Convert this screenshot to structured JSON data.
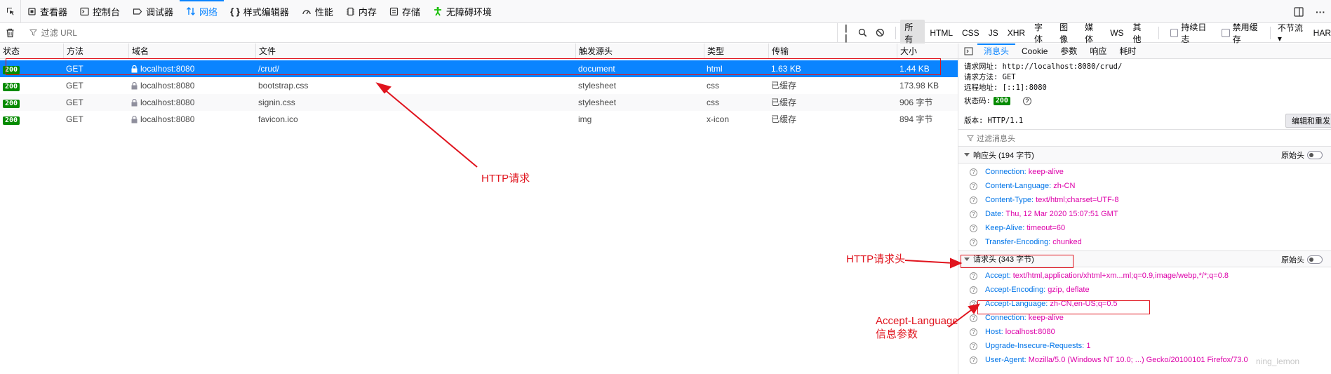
{
  "toolbar": {
    "tools": [
      {
        "label": "查看器",
        "icon": "inspector-icon"
      },
      {
        "label": "控制台",
        "icon": "console-icon"
      },
      {
        "label": "调试器",
        "icon": "debugger-icon"
      },
      {
        "label": "网络",
        "icon": "network-icon",
        "active": true
      },
      {
        "label": "样式编辑器",
        "icon": "style-editor-icon"
      },
      {
        "label": "性能",
        "icon": "performance-icon"
      },
      {
        "label": "内存",
        "icon": "memory-icon"
      },
      {
        "label": "存储",
        "icon": "storage-icon"
      },
      {
        "label": "无障碍环境",
        "icon": "accessibility-icon"
      }
    ],
    "more": "···"
  },
  "filterbar": {
    "placeholder": "过滤 URL",
    "types": [
      "所有",
      "HTML",
      "CSS",
      "JS",
      "XHR",
      "字体",
      "图像",
      "媒体",
      "WS",
      "其他"
    ],
    "persist_logs": "持续日志",
    "disable_cache": "禁用缓存",
    "throttle": "不节流 ▾",
    "har": "HAR"
  },
  "table": {
    "headers": [
      "状态",
      "方法",
      "域名",
      "文件",
      "触发源头",
      "类型",
      "传输",
      "大小"
    ],
    "rows": [
      {
        "status": "200",
        "method": "GET",
        "domain": "localhost:8080",
        "file": "/crud/",
        "cause": "document",
        "type": "html",
        "transferred": "1.63 KB",
        "size": "1.44 KB"
      },
      {
        "status": "200",
        "method": "GET",
        "domain": "localhost:8080",
        "file": "bootstrap.css",
        "cause": "stylesheet",
        "type": "css",
        "transferred": "已缓存",
        "size": "173.98 KB"
      },
      {
        "status": "200",
        "method": "GET",
        "domain": "localhost:8080",
        "file": "signin.css",
        "cause": "stylesheet",
        "type": "css",
        "transferred": "已缓存",
        "size": "906 字节"
      },
      {
        "status": "200",
        "method": "GET",
        "domain": "localhost:8080",
        "file": "favicon.ico",
        "cause": "img",
        "type": "x-icon",
        "transferred": "已缓存",
        "size": "894 字节"
      }
    ]
  },
  "side": {
    "tabs": [
      "消息头",
      "Cookie",
      "参数",
      "响应",
      "耗时"
    ],
    "request_url": "请求网址: http://localhost:8080/crud/",
    "request_method": "请求方法: GET",
    "remote_address": "远程地址: [::1]:8080",
    "status_label": "状态码:",
    "status_code": "200",
    "help": "?",
    "version": "版本: HTTP/1.1",
    "edit_resend": "编辑和重发",
    "filter_placeholder": "过滤消息头",
    "raw_label": "原始头",
    "response_group": "响应头 (194 字节)",
    "request_group": "请求头 (343 字节)",
    "response_headers": [
      {
        "k": "Connection:",
        "v": "keep-alive"
      },
      {
        "k": "Content-Language:",
        "v": "zh-CN"
      },
      {
        "k": "Content-Type:",
        "v": "text/html;charset=UTF-8"
      },
      {
        "k": "Date:",
        "v": "Thu, 12 Mar 2020 15:07:51 GMT"
      },
      {
        "k": "Keep-Alive:",
        "v": "timeout=60"
      },
      {
        "k": "Transfer-Encoding:",
        "v": "chunked"
      }
    ],
    "request_headers": [
      {
        "k": "Accept:",
        "v": "text/html,application/xhtml+xm...ml;q=0.9,image/webp,*/*;q=0.8"
      },
      {
        "k": "Accept-Encoding:",
        "v": "gzip, deflate"
      },
      {
        "k": "Accept-Language:",
        "v": "zh-CN,en-US;q=0.5"
      },
      {
        "k": "Connection:",
        "v": "keep-alive"
      },
      {
        "k": "Host:",
        "v": "localhost:8080"
      },
      {
        "k": "Upgrade-Insecure-Requests:",
        "v": "1"
      },
      {
        "k": "User-Agent:",
        "v": "Mozilla/5.0 (Windows NT 10.0; ...) Gecko/20100101 Firefox/73.0"
      }
    ]
  },
  "annotations": {
    "http_request": "HTTP请求",
    "http_request_header": "HTTP请求头",
    "accept_language_line1": "Accept-Language",
    "accept_language_line2": "信息参数",
    "color": "#e0141e"
  },
  "watermark": "ning_lemon"
}
